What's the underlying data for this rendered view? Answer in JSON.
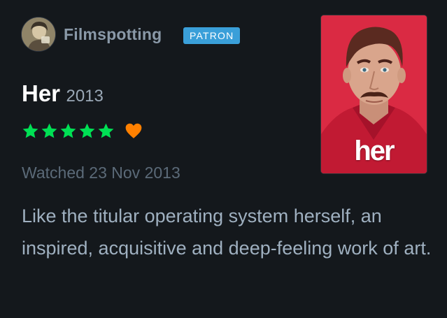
{
  "user": {
    "name": "Filmspotting",
    "badge": "PATRON"
  },
  "film": {
    "title": "Her",
    "year": "2013",
    "poster_title": "her"
  },
  "rating": {
    "stars": 5,
    "max_stars": 5,
    "liked": true,
    "star_color": "#00e054",
    "heart_color": "#ff8000"
  },
  "watched_text": "Watched 23 Nov 2013",
  "review_text": "Like the titular operating system herself, an inspired, acquisitive and deep-feeling work of art.",
  "colors": {
    "background": "#14181c",
    "badge": "#3a9fd9",
    "poster_red": "#d8263f"
  }
}
